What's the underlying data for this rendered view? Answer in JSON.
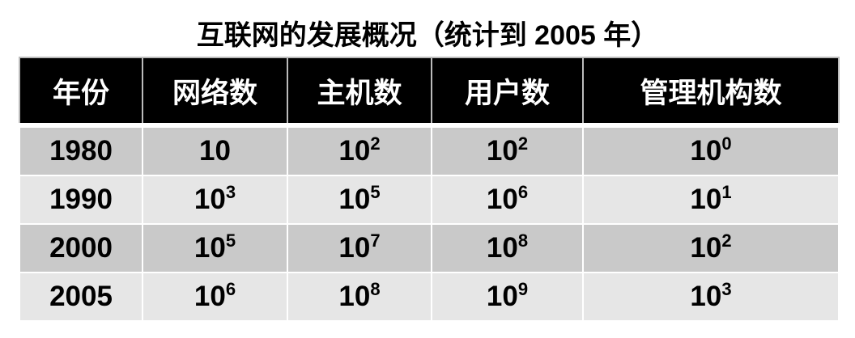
{
  "title": "互联网的发展概况（统计到 2005 年）",
  "headers": [
    "年份",
    "网络数",
    "主机数",
    "用户数",
    "管理机构数"
  ],
  "rows": [
    [
      {
        "base": "1980"
      },
      {
        "base": "10"
      },
      {
        "base": "10",
        "exp": "2"
      },
      {
        "base": "10",
        "exp": "2"
      },
      {
        "base": "10",
        "exp": "0"
      }
    ],
    [
      {
        "base": "1990"
      },
      {
        "base": "10",
        "exp": "3"
      },
      {
        "base": "10",
        "exp": "5"
      },
      {
        "base": "10",
        "exp": "6"
      },
      {
        "base": "10",
        "exp": "1"
      }
    ],
    [
      {
        "base": "2000"
      },
      {
        "base": "10",
        "exp": "5"
      },
      {
        "base": "10",
        "exp": "7"
      },
      {
        "base": "10",
        "exp": "8"
      },
      {
        "base": "10",
        "exp": "2"
      }
    ],
    [
      {
        "base": "2005"
      },
      {
        "base": "10",
        "exp": "6"
      },
      {
        "base": "10",
        "exp": "8"
      },
      {
        "base": "10",
        "exp": "9"
      },
      {
        "base": "10",
        "exp": "3"
      }
    ]
  ]
}
